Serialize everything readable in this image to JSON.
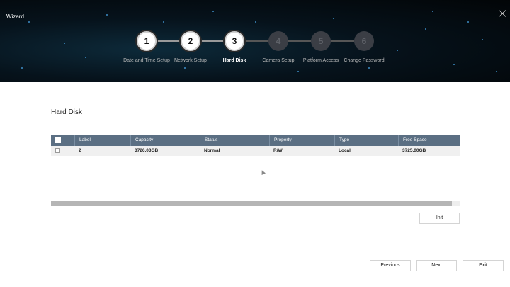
{
  "window": {
    "title": "Wizard"
  },
  "steps": [
    {
      "number": "1",
      "label": "Date and Time Setup",
      "state": "done"
    },
    {
      "number": "2",
      "label": "Network Setup",
      "state": "done"
    },
    {
      "number": "3",
      "label": "Hard Disk",
      "state": "current"
    },
    {
      "number": "4",
      "label": "Camera Setup",
      "state": "pending"
    },
    {
      "number": "5",
      "label": "Platform Access",
      "state": "pending"
    },
    {
      "number": "6",
      "label": "Change Password",
      "state": "pending"
    }
  ],
  "page": {
    "section_title": "Hard Disk"
  },
  "table": {
    "columns": [
      "Label",
      "Capacity",
      "Status",
      "Property",
      "Type",
      "Free Space"
    ],
    "rows": [
      {
        "label": "2",
        "capacity": "3726.03GB",
        "status": "Normal",
        "property": "R/W",
        "type": "Local",
        "free_space": "3725.00GB",
        "checked": false
      }
    ]
  },
  "buttons": {
    "init": "Init",
    "previous": "Previous",
    "next": "Next",
    "exit": "Exit"
  },
  "colors": {
    "table_header": "#5b6f83",
    "header_bg": "#06121b",
    "accent_spark": "#4fb6ff"
  }
}
